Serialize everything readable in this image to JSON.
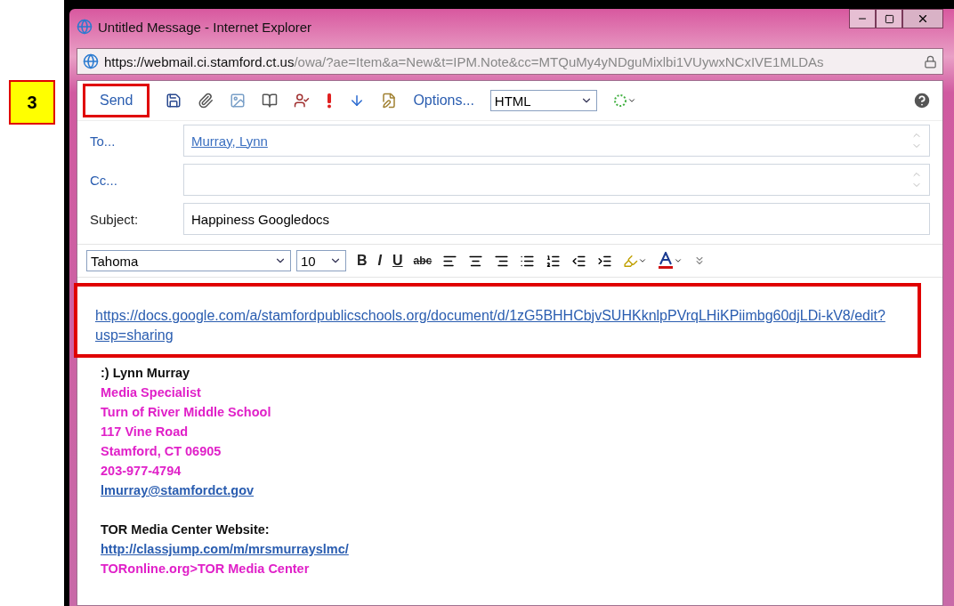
{
  "step_badge": "3",
  "window": {
    "title": "Untitled Message - Internet Explorer",
    "address": {
      "host_prefix": "https://webmail.ci.",
      "host": "stamford.ct.us",
      "path": "/owa/?ae=Item&a=New&t=IPM.Note&cc=MTQuMy4yNDguMixlbi1VUywxNCxIVE1MLDAs"
    }
  },
  "toolbar": {
    "send": {
      "label": "Send",
      "highlighted": true
    },
    "options": "Options...",
    "format_select": "HTML"
  },
  "fields": [
    {
      "kind": "recipient",
      "label": "To...",
      "value": "Murray, Lynn"
    },
    {
      "kind": "recipient",
      "label": "Cc..."
    },
    {
      "kind": "text",
      "label": "Subject:",
      "value": "Happiness Googledocs"
    }
  ],
  "format_bar": {
    "font": "Tahoma",
    "size": "10",
    "buttons": [
      {
        "kind": "bold",
        "text": "B"
      },
      {
        "kind": "italic",
        "text": "I"
      },
      {
        "kind": "underline",
        "text": "U"
      },
      {
        "kind": "strike",
        "text": "abc"
      }
    ]
  },
  "body": {
    "link": {
      "text": "https://docs.google.com/a/stamfordpublicschools.org/document/d/1zG5BHHCbjvSUHKknlpPVrqLHiKPiimbg60djLDi-kV8/edit?usp=sharing",
      "highlighted": true
    },
    "signature": [
      {
        "kind": "name",
        "text": ":) Lynn Murray"
      },
      {
        "kind": "info",
        "text": "Media Specialist"
      },
      {
        "kind": "info",
        "text": "Turn of River Middle School"
      },
      {
        "kind": "info",
        "text": "117 Vine Road"
      },
      {
        "kind": "info",
        "text": "Stamford, CT 06905"
      },
      {
        "kind": "info",
        "text": "203-977-4794"
      },
      {
        "kind": "link",
        "text": "lmurray@stamfordct.gov"
      },
      {
        "kind": "gap"
      },
      {
        "kind": "name",
        "text": "TOR Media Center Website:"
      },
      {
        "kind": "link",
        "text": "http://classjump.com/m/mrsmurrayslmc/"
      },
      {
        "kind": "info",
        "text": "TORonline.org>TOR Media Center"
      }
    ]
  }
}
